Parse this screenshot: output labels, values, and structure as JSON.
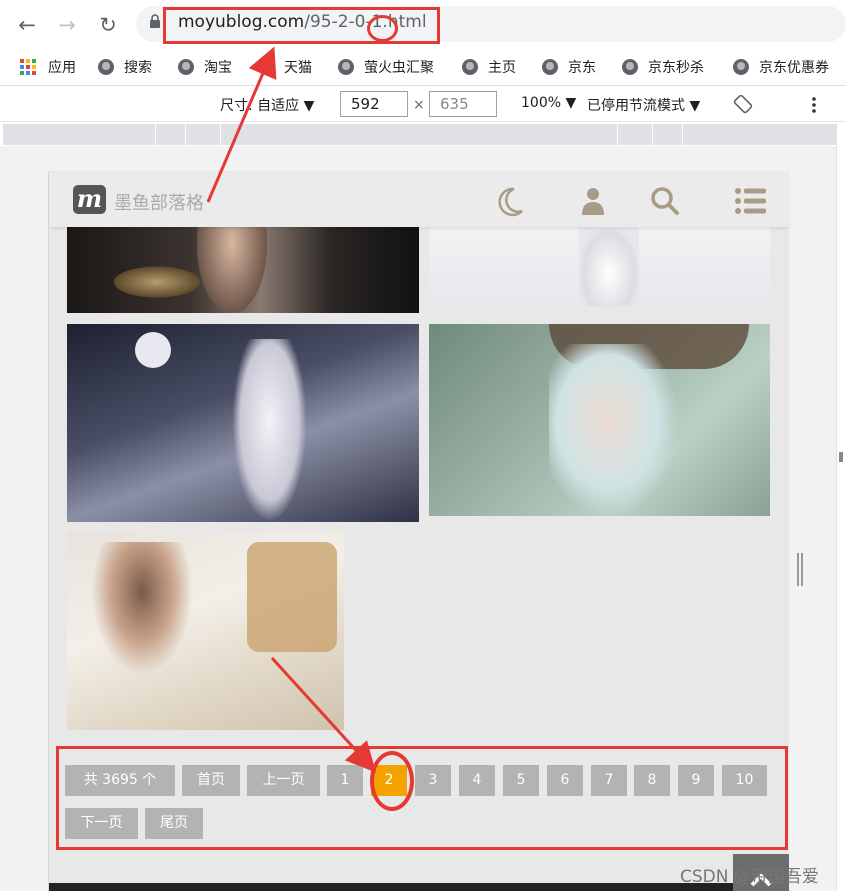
{
  "browser": {
    "url_host": "moyublog.com",
    "url_path": "/95-2-0-1.html",
    "bookmarks": [
      {
        "label": "应用",
        "icon": "apps-grid-icon"
      },
      {
        "label": "搜索",
        "icon": "globe-icon"
      },
      {
        "label": "淘宝",
        "icon": "globe-icon"
      },
      {
        "label": "天猫",
        "icon": "globe-icon"
      },
      {
        "label": "萤火虫汇聚",
        "icon": "globe-icon"
      },
      {
        "label": "主页",
        "icon": "globe-icon"
      },
      {
        "label": "京东",
        "icon": "globe-icon"
      },
      {
        "label": "京东秒杀",
        "icon": "globe-icon"
      },
      {
        "label": "京东优惠券",
        "icon": "globe-icon"
      }
    ]
  },
  "devtools": {
    "size_label": "尺寸: 自适应 ▼",
    "width": "592",
    "times": "×",
    "height": "635",
    "zoom": "100% ▼",
    "throttle": "已停用节流模式 ▼"
  },
  "site": {
    "name": "墨鱼部落格",
    "logo_letter": "m"
  },
  "pagination": {
    "total": "共 3695 个",
    "first": "首页",
    "prev": "上一页",
    "pages": [
      "1",
      "2",
      "3",
      "4",
      "5",
      "6",
      "7",
      "8",
      "9",
      "10"
    ],
    "current": "2",
    "next": "下一页",
    "last": "尾页"
  },
  "watermark": "CSDN @帝国吾爱",
  "colors": {
    "accent": "#f5a300",
    "annotation_red": "#e53935",
    "page_button": "#b3b3b3"
  }
}
